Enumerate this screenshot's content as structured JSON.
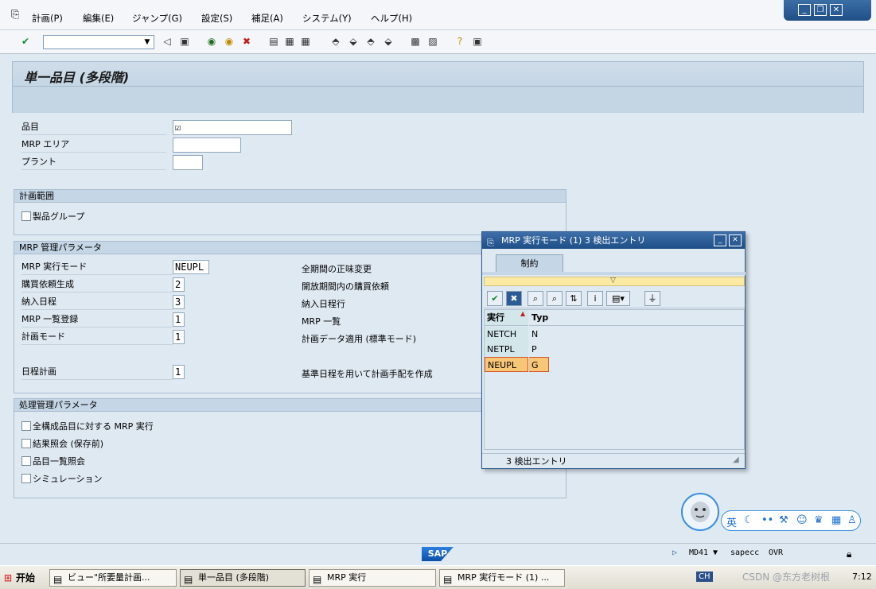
{
  "menu": {
    "items": [
      "計画(P)",
      "編集(E)",
      "ジャンプ(G)",
      "設定(S)",
      "補足(A)",
      "システム(Y)",
      "ヘルプ(H)"
    ]
  },
  "window_controls": {
    "minimize": "_",
    "restore": "❐",
    "close": "✕"
  },
  "toolbar": {
    "command_field_value": ""
  },
  "screen": {
    "title": "単一品目 (多段階)"
  },
  "selection": {
    "material_label": "品目",
    "material_value": "☑",
    "mrp_area_label": "MRP エリア",
    "mrp_area_value": "",
    "plant_label": "プラント",
    "plant_value": ""
  },
  "scope": {
    "title": "計画範囲",
    "product_group_label": "製品グループ"
  },
  "mrp_params": {
    "title": "MRP 管理パラメータ",
    "rows": [
      {
        "label": "MRP 実行モード",
        "value": "NEUPL",
        "desc": "全期間の正味変更"
      },
      {
        "label": "購買依頼生成",
        "value": "2",
        "desc": "開放期間内の購買依頼"
      },
      {
        "label": "納入日程",
        "value": "3",
        "desc": "納入日程行"
      },
      {
        "label": "MRP 一覧登録",
        "value": "1",
        "desc": "MRP 一覧"
      },
      {
        "label": "計画モード",
        "value": "1",
        "desc": "計画データ適用 (標準モード)"
      },
      {
        "label": "日程計画",
        "value": "1",
        "desc": "基準日程を用いて計画手配を作成"
      }
    ]
  },
  "process_params": {
    "title": "処理管理パラメータ",
    "checkboxes": [
      "全構成品目に対する MRP 実行",
      "結果照会 (保存前)",
      "品目一覧照会",
      "シミュレーション"
    ]
  },
  "popup": {
    "title": "MRP 実行モード (1)   3 検出エントリ",
    "tab": "制約",
    "columns": [
      "実行",
      "Typ"
    ],
    "rows": [
      {
        "code": "NETCH",
        "type": "N"
      },
      {
        "code": "NETPL",
        "type": "P"
      },
      {
        "code": "NEUPL",
        "type": "G"
      }
    ],
    "status": "3 検出エントリ"
  },
  "statusbar": {
    "logo": "SAP",
    "transaction": "MD41",
    "server": "sapecc",
    "mode": "OVR"
  },
  "taskbar": {
    "start": "开始",
    "tasks": [
      "ビュー\"所要量計画...",
      "単一品目 (多段階)",
      "MRP 実行",
      "MRP 実行モード (1) ..."
    ],
    "tray_lang": "CH",
    "tray_time": "7:12",
    "watermark": "CSDN @东方老树根"
  },
  "ime": {
    "mode_label": "英"
  }
}
